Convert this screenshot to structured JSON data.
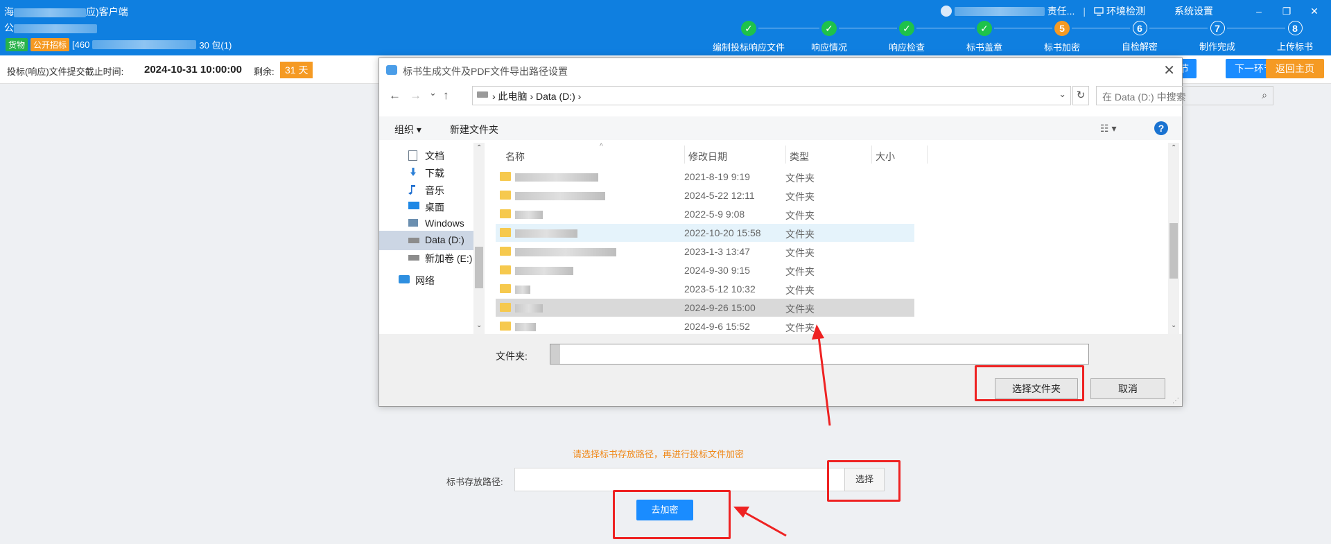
{
  "header": {
    "app_title_prefix": "海",
    "app_title_suffix": "应)客户端",
    "project_prefix": "公",
    "tag_green": "货物",
    "tag_orange": "公开招标",
    "bid_prefix": "[460",
    "bid_suffix": "30  包(1)",
    "user_suffix": "责任...",
    "env_check": "环境检测",
    "sys_settings": "系统设置",
    "minimize": "–",
    "restore": "❐",
    "close": "✕"
  },
  "steps": [
    {
      "label": "编制投标响应文件",
      "state": "done",
      "mark": "✓"
    },
    {
      "label": "响应情况",
      "state": "done",
      "mark": "✓"
    },
    {
      "label": "响应检查",
      "state": "done",
      "mark": "✓"
    },
    {
      "label": "标书盖章",
      "state": "done",
      "mark": "✓"
    },
    {
      "label": "标书加密",
      "state": "current",
      "mark": "5"
    },
    {
      "label": "自检解密",
      "state": "todo",
      "mark": "6"
    },
    {
      "label": "制作完成",
      "state": "todo",
      "mark": "7"
    },
    {
      "label": "上传标书",
      "state": "todo",
      "mark": "8"
    }
  ],
  "deadline": {
    "label": "投标(响应)文件提交截止时间:",
    "value": "2024-10-31 10:00:00",
    "remain_label": "剩余:",
    "remain_days": "31 天"
  },
  "top_buttons": {
    "prev_partial": "节",
    "next": "下一环节",
    "home": "返回主页"
  },
  "dialog": {
    "title": "标书生成文件及PDF文件导出路径设置",
    "close": "✕",
    "nav_back": "←",
    "nav_forward": "→",
    "nav_recent": "⌄",
    "nav_up": "↑",
    "address": "›   此电脑   ›   Data (D:)   ›",
    "address_chevron": "⌄",
    "refresh": "↻",
    "search_placeholder": "在 Data (D:) 中搜索",
    "search_icon": "⌕",
    "organize": "组织 ▾",
    "new_folder": "新建文件夹",
    "view_icon": "☷ ▾",
    "help": "?",
    "nav_items": [
      {
        "label": "文档",
        "icon": "document-icon"
      },
      {
        "label": "下载",
        "icon": "download-icon"
      },
      {
        "label": "音乐",
        "icon": "music-icon"
      },
      {
        "label": "桌面",
        "icon": "desktop-icon"
      },
      {
        "label": "Windows",
        "icon": "windows-drive-icon"
      },
      {
        "label": "Data (D:)",
        "icon": "drive-icon"
      },
      {
        "label": "新加卷 (E:)",
        "icon": "drive-icon"
      },
      {
        "label": "网络",
        "icon": "network-icon"
      }
    ],
    "columns": {
      "name": "名称",
      "date": "修改日期",
      "type": "类型",
      "size": "大小"
    },
    "rows": [
      {
        "date": "2021-8-19 9:19",
        "type": "文件夹"
      },
      {
        "date": "2024-5-22 12:11",
        "type": "文件夹"
      },
      {
        "date": "2022-5-9 9:08",
        "type": "文件夹"
      },
      {
        "date": "2022-10-20 15:58",
        "type": "文件夹"
      },
      {
        "date": "2023-1-3 13:47",
        "type": "文件夹"
      },
      {
        "date": "2024-9-30 9:15",
        "type": "文件夹"
      },
      {
        "date": "2023-5-12 10:32",
        "type": "文件夹"
      },
      {
        "date": "2024-9-26 15:00",
        "type": "文件夹"
      },
      {
        "date": "2024-9-6 15:52",
        "type": "文件夹"
      }
    ],
    "folder_label": "文件夹:",
    "select_folder": "选择文件夹",
    "cancel": "取消"
  },
  "page": {
    "hint": "请选择标书存放路径，再进行投标文件加密",
    "path_label": "标书存放路径:",
    "choose": "选择",
    "encrypt": "去加密"
  }
}
